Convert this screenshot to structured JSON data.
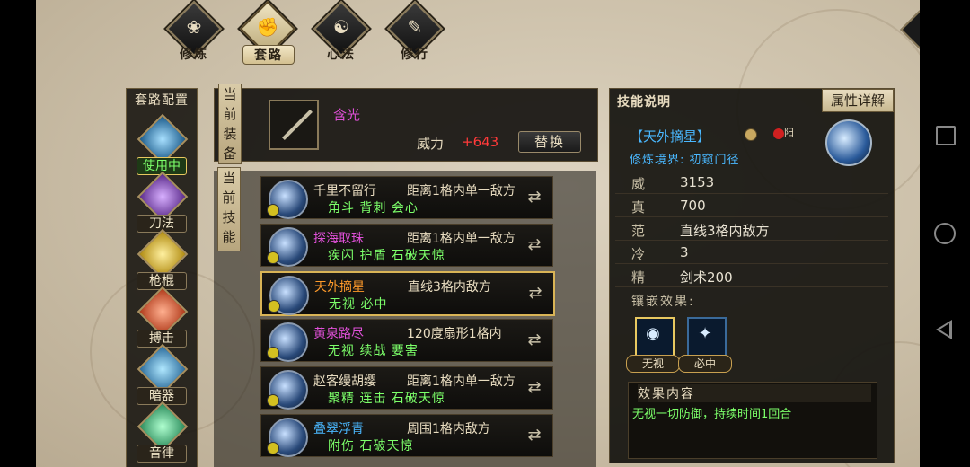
{
  "top_tabs": [
    {
      "label": "修炼",
      "icon": "lotus-icon"
    },
    {
      "label": "套路",
      "icon": "fist-icon"
    },
    {
      "label": "心法",
      "icon": "taiji-icon"
    },
    {
      "label": "修行",
      "icon": "scroll-icon"
    }
  ],
  "left_column": {
    "title": "套路配置",
    "categories": [
      {
        "label": "使用中",
        "icon": "sword-icon",
        "active": true
      },
      {
        "label": "刀法",
        "icon": "blade-icon"
      },
      {
        "label": "枪棍",
        "icon": "spear-icon"
      },
      {
        "label": "搏击",
        "icon": "fist-icon"
      },
      {
        "label": "暗器",
        "icon": "dart-icon"
      },
      {
        "label": "音律",
        "icon": "music-icon"
      }
    ]
  },
  "equipment": {
    "tag": "当前装备",
    "item_name": "含光",
    "power_label": "威力",
    "power_value": "+643",
    "replace_label": "替换"
  },
  "skills": {
    "tag": "当前技能",
    "rows": [
      {
        "name": "千里不留行",
        "name_color": "#e8dcc0",
        "range": "距离1格内单一敌方",
        "tags": "角斗 背刺 会心"
      },
      {
        "name": "探海取珠",
        "name_color": "#e050d8",
        "range": "距离1格内单一敌方",
        "tags": "疾闪 护盾 石破天惊"
      },
      {
        "name": "天外摘星",
        "name_color": "#ff9a2a",
        "range": "直线3格内敌方",
        "tags": "无视 必中",
        "selected": true
      },
      {
        "name": "黄泉路尽",
        "name_color": "#e050d8",
        "range": "120度扇形1格内",
        "tags": "无视 续战 要害"
      },
      {
        "name": "赵客缦胡缨",
        "name_color": "#e8dcc0",
        "range": "距离1格内单一敌方",
        "tags": "聚精 连击 石破天惊"
      },
      {
        "name": "叠翠浮青",
        "name_color": "#4ab8ff",
        "range": "周围1格内敌方",
        "tags": "附伤 石破天惊"
      }
    ]
  },
  "detail": {
    "tab_desc": "技能说明",
    "tab_attr": "属性详解",
    "skill_title": "【天外摘星】",
    "yang_label": "阳",
    "realm": "修炼境界: 初窥门径",
    "stats": [
      {
        "key": "威",
        "value": "3153"
      },
      {
        "key": "真",
        "value": "700"
      },
      {
        "key": "范",
        "value": "直线3格内敌方"
      },
      {
        "key": "冷",
        "value": "3"
      },
      {
        "key": "精",
        "value": "剑术200"
      }
    ],
    "inlay_label": "镶嵌效果:",
    "inlays": [
      {
        "label": "无视",
        "icon": "eye-icon",
        "selected": true
      },
      {
        "label": "必中",
        "icon": "target-icon"
      }
    ],
    "effect_title": "效果内容",
    "effect_text": "无视一切防御，持续时间1回合"
  }
}
